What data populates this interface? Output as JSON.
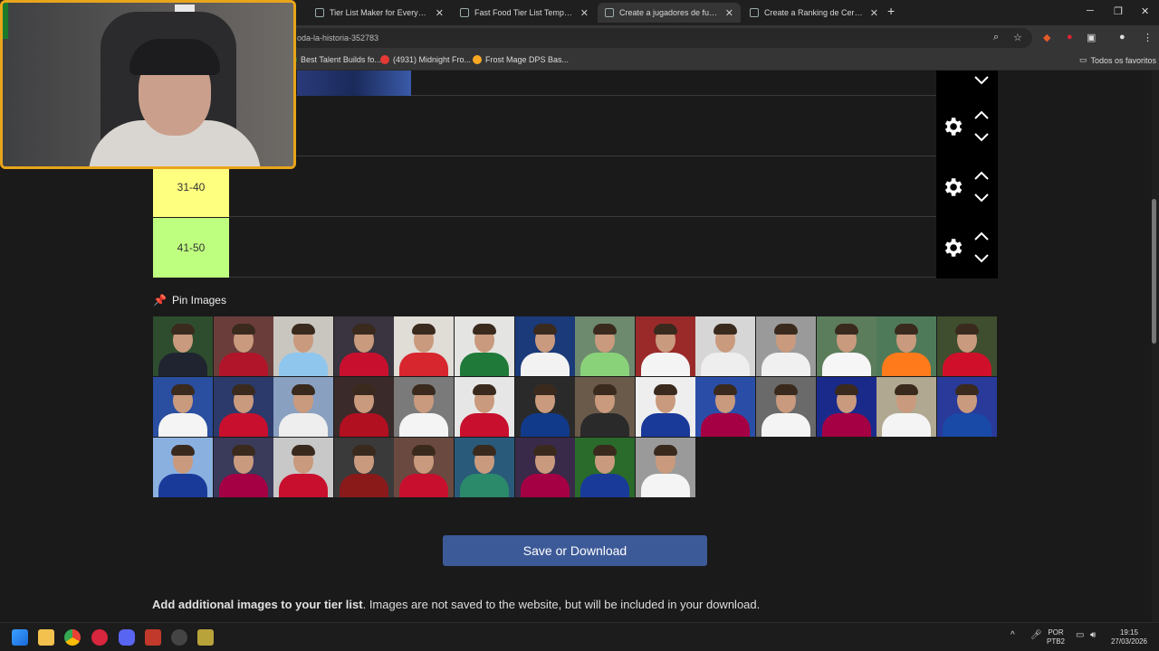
{
  "browser": {
    "tabs": [
      {
        "title": "Tier List Maker for Everything -",
        "active": false
      },
      {
        "title": "Fast Food Tier List Templates -",
        "active": false
      },
      {
        "title": "Create a jugadores de futbol de",
        "active": true
      },
      {
        "title": "Create a Ranking de Cerveja Co",
        "active": false
      }
    ],
    "new_tab": "+",
    "address": "oda-la-historia-352783",
    "bookmarks": [
      {
        "label": "Best Talent Builds fo...",
        "color": "#2e7d32"
      },
      {
        "label": "(4931) Midnight Fro...",
        "color": "#e53935"
      },
      {
        "label": "Frost Mage DPS Bas...",
        "color": "#f9a825"
      }
    ],
    "favorites_label": "Todos os favoritos"
  },
  "tiers": [
    {
      "label": "",
      "color": "#1a1a1a",
      "has_images": true
    },
    {
      "label": "",
      "color": "#1a1a1a",
      "has_images": false
    },
    {
      "label": "31-40",
      "color": "#ffff7f",
      "has_images": false
    },
    {
      "label": "41-50",
      "color": "#bfff7f",
      "has_images": false
    }
  ],
  "pin_images": {
    "label": "Pin Images",
    "icon": "pushpin-icon"
  },
  "players": [
    {
      "shirt": "#1f2430",
      "bg": "#2e4d2e"
    },
    {
      "shirt": "#b0152a",
      "bg": "#6b3d3a"
    },
    {
      "shirt": "#8ec6ee",
      "bg": "#c9c6c0"
    },
    {
      "shirt": "#c8102e",
      "bg": "#3a3440"
    },
    {
      "shirt": "#d7262e",
      "bg": "#e0dcd6"
    },
    {
      "shirt": "#1f7a3a",
      "bg": "#e4e4e2"
    },
    {
      "shirt": "#f2f2f2",
      "bg": "#1a3a7a"
    },
    {
      "shirt": "#8ad27a",
      "bg": "#6e8a6e"
    },
    {
      "shirt": "#f4f4f4",
      "bg": "#9a2a2a"
    },
    {
      "shirt": "#eeeeee",
      "bg": "#d6d6d6"
    },
    {
      "shirt": "#f0f0f0",
      "bg": "#9a9a9a"
    },
    {
      "shirt": "#f6f6f6",
      "bg": "#5c7d5c"
    },
    {
      "shirt": "#ff7a1a",
      "bg": "#4f7a5a"
    },
    {
      "shirt": "#d0102a",
      "bg": "#3e4e2e"
    },
    {
      "shirt": "#f4f4f4",
      "bg": "#2a4ea0"
    },
    {
      "shirt": "#c8102e",
      "bg": "#2b3a6a"
    },
    {
      "shirt": "#eeeeee",
      "bg": "#8aa0c0"
    },
    {
      "shirt": "#b01020",
      "bg": "#3a2a2a"
    },
    {
      "shirt": "#f4f4f4",
      "bg": "#7a7a7a"
    },
    {
      "shirt": "#c8102e",
      "bg": "#e6e6e6"
    },
    {
      "shirt": "#123a8a",
      "bg": "#2a2a2a"
    },
    {
      "shirt": "#2a2a2a",
      "bg": "#6a5a4a"
    },
    {
      "shirt": "#1a3a9a",
      "bg": "#eeeeee"
    },
    {
      "shirt": "#a50044",
      "bg": "#2a4ea8"
    },
    {
      "shirt": "#f4f4f4",
      "bg": "#6a6a6a"
    },
    {
      "shirt": "#a50044",
      "bg": "#1a2a8a"
    },
    {
      "shirt": "#f4f4f4",
      "bg": "#b0a890"
    },
    {
      "shirt": "#1a4aa8",
      "bg": "#2a3a9a"
    },
    {
      "shirt": "#1a3a9a",
      "bg": "#8ab0e0"
    },
    {
      "shirt": "#a50044",
      "bg": "#3a3a5a"
    },
    {
      "shirt": "#c8102e",
      "bg": "#c8c8c8"
    },
    {
      "shirt": "#8a1a1a",
      "bg": "#3a3a3a"
    },
    {
      "shirt": "#c8102e",
      "bg": "#6a4a40"
    },
    {
      "shirt": "#2a8a6a",
      "bg": "#2a5a7a"
    },
    {
      "shirt": "#a50044",
      "bg": "#3a2a4a"
    },
    {
      "shirt": "#1a3a9a",
      "bg": "#2a6a2a"
    },
    {
      "shirt": "#f4f4f4",
      "bg": "#9a9a9a"
    }
  ],
  "save_button": "Save or Download",
  "additional": {
    "bold": "Add additional images to your tier list",
    "rest": ". Images are not saved to the website, but will be included in your download."
  },
  "taskbar": {
    "lang_line1": "POR",
    "lang_line2": "PTB2",
    "time": "19:15",
    "date": "27/03/2026"
  }
}
